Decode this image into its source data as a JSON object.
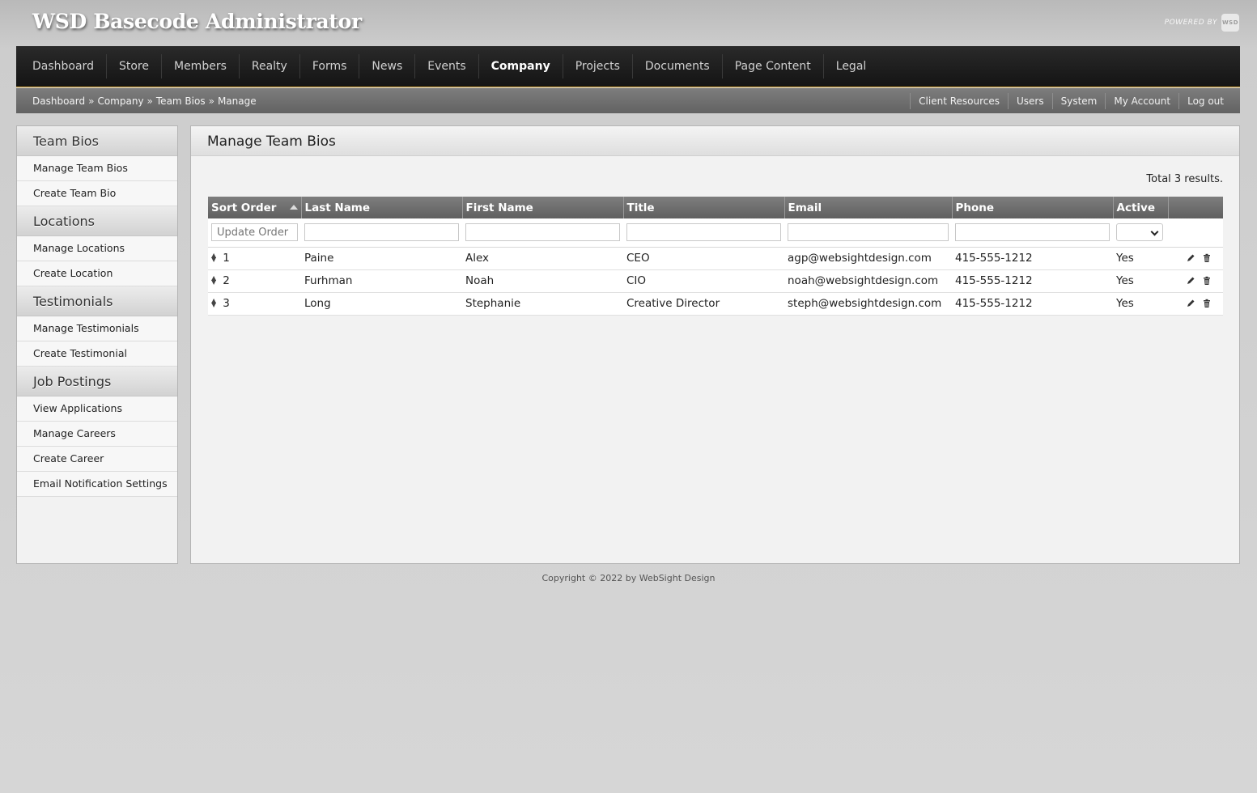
{
  "header": {
    "app_title": "WSD Basecode Administrator",
    "powered_by": "POWERED BY",
    "powered_badge": "WSD"
  },
  "main_nav": [
    {
      "label": "Dashboard",
      "active": false
    },
    {
      "label": "Store",
      "active": false
    },
    {
      "label": "Members",
      "active": false
    },
    {
      "label": "Realty",
      "active": false
    },
    {
      "label": "Forms",
      "active": false
    },
    {
      "label": "News",
      "active": false
    },
    {
      "label": "Events",
      "active": false
    },
    {
      "label": "Company",
      "active": true
    },
    {
      "label": "Projects",
      "active": false
    },
    {
      "label": "Documents",
      "active": false
    },
    {
      "label": "Page Content",
      "active": false
    },
    {
      "label": "Legal",
      "active": false
    }
  ],
  "breadcrumb": [
    "Dashboard",
    "Company",
    "Team Bios",
    "Manage"
  ],
  "breadcrumb_separator": "»",
  "utility_nav": [
    "Client Resources",
    "Users",
    "System",
    "My Account",
    "Log out"
  ],
  "sidebar": {
    "sections": [
      {
        "heading": "Team Bios",
        "links": [
          "Manage Team Bios",
          "Create Team Bio"
        ]
      },
      {
        "heading": "Locations",
        "links": [
          "Manage Locations",
          "Create Location"
        ]
      },
      {
        "heading": "Testimonials",
        "links": [
          "Manage Testimonials",
          "Create Testimonial"
        ]
      },
      {
        "heading": "Job Postings",
        "links": [
          "View Applications",
          "Manage Careers",
          "Create Career",
          "Email Notification Settings"
        ]
      }
    ]
  },
  "content": {
    "title": "Manage Team Bios",
    "total_text": "Total 3 results.",
    "columns": [
      "Sort Order",
      "Last Name",
      "First Name",
      "Title",
      "Email",
      "Phone",
      "Active",
      ""
    ],
    "update_order_placeholder": "Update Order",
    "rows": [
      {
        "sort": "1",
        "last": "Paine",
        "first": "Alex",
        "title": "CEO",
        "email": "agp@websightdesign.com",
        "phone": "415-555-1212",
        "active": "Yes"
      },
      {
        "sort": "2",
        "last": "Furhman",
        "first": "Noah",
        "title": "CIO",
        "email": "noah@websightdesign.com",
        "phone": "415-555-1212",
        "active": "Yes"
      },
      {
        "sort": "3",
        "last": "Long",
        "first": "Stephanie",
        "title": "Creative Director",
        "email": "steph@websightdesign.com",
        "phone": "415-555-1212",
        "active": "Yes"
      }
    ]
  },
  "footer": {
    "text": "Copyright © 2022 by WebSight Design"
  },
  "icons": {
    "drag": "drag-handle-icon",
    "edit": "pencil-icon",
    "delete": "trash-icon",
    "sort": "sort-ascending-icon"
  },
  "colors": {
    "nav_accent": "#d8a83a",
    "nav_bg": "#1c1c1c",
    "header_bg": "#6e6e6e"
  }
}
